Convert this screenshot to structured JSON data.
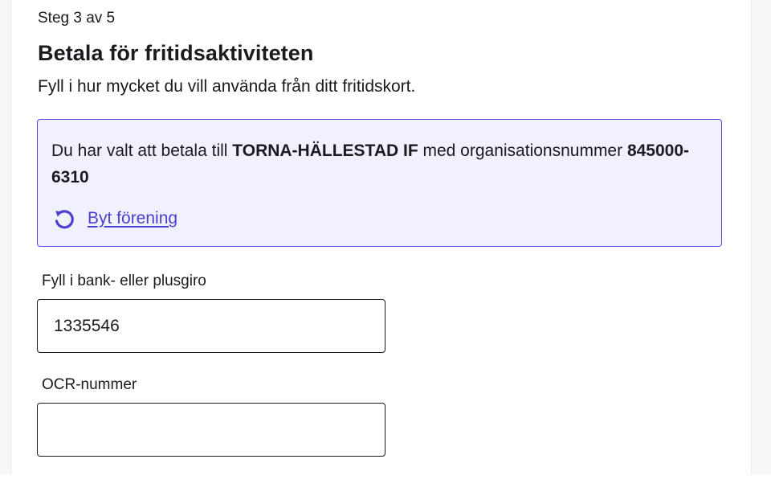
{
  "step_indicator": "Steg 3 av 5",
  "title": "Betala för fritidsaktiviteten",
  "subtitle": "Fyll i hur mycket du vill använda från ditt fritidskort.",
  "info_box": {
    "text_before": "Du har valt att betala till ",
    "association_name": "TORNA-HÄLLESTAD IF",
    "text_middle": " med organisationsnummer ",
    "org_number": "845000-6310",
    "change_link_label": "Byt förening",
    "change_link_icon": "refresh-icon"
  },
  "fields": {
    "bank_giro": {
      "label": "Fyll i bank- eller plusgiro",
      "value": "1335546",
      "placeholder": ""
    },
    "ocr": {
      "label": "OCR-nummer",
      "value": "",
      "placeholder": ""
    }
  },
  "colors": {
    "accent": "#4b3fd0",
    "info_background": "#f1f0fd",
    "info_border": "#5b4ed6",
    "text": "#1b1b1f"
  }
}
